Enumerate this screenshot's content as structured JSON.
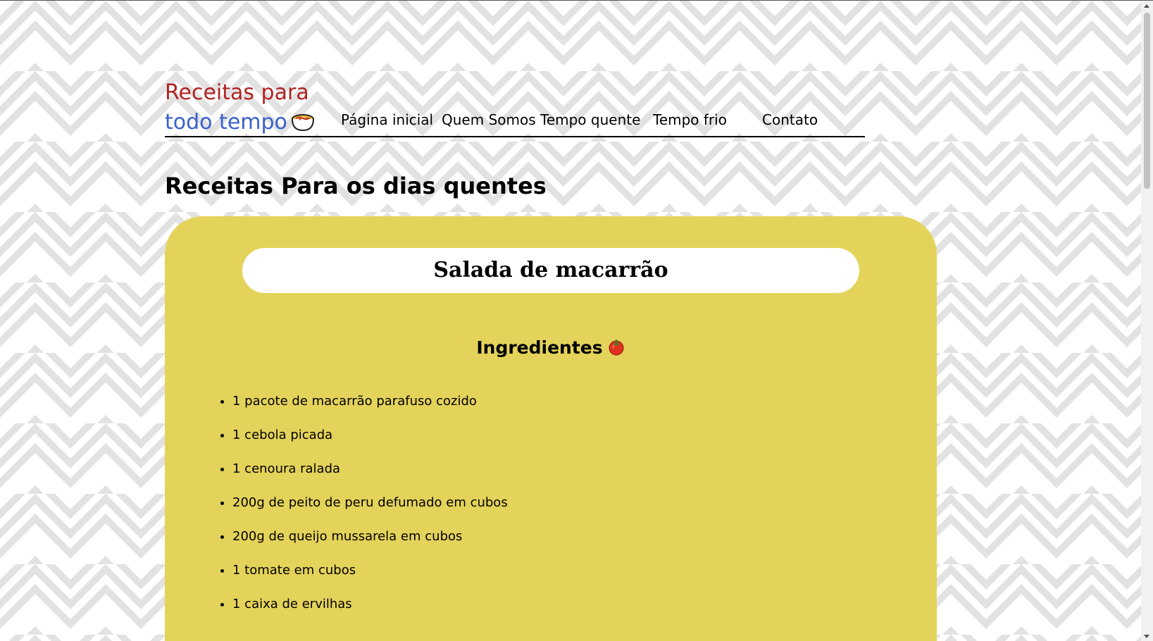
{
  "logo": {
    "line1": "Receitas para",
    "line2": "todo tempo",
    "icon": "bowl-icon",
    "color_line1": "#b22222",
    "color_line2": "#3a5fcd"
  },
  "nav": {
    "items": [
      {
        "label": "Página inicial"
      },
      {
        "label": "Quem Somos"
      },
      {
        "label": "Tempo quente"
      },
      {
        "label": "Tempo frio"
      },
      {
        "label": "Contato"
      }
    ]
  },
  "page": {
    "title": "Receitas Para os dias quentes"
  },
  "recipe": {
    "name": "Salada de macarrão",
    "ingredients_title": "Ingredientes",
    "ingredients_icon": "tomato-icon",
    "card_color": "#e4d35a",
    "ingredients": [
      "1 pacote de macarrão parafuso cozido",
      "1 cebola picada",
      "1 cenoura ralada",
      "200g de peito de peru defumado em cubos",
      "200g de queijo mussarela em cubos",
      "1 tomate em cubos",
      "1 caixa de ervilhas"
    ]
  }
}
